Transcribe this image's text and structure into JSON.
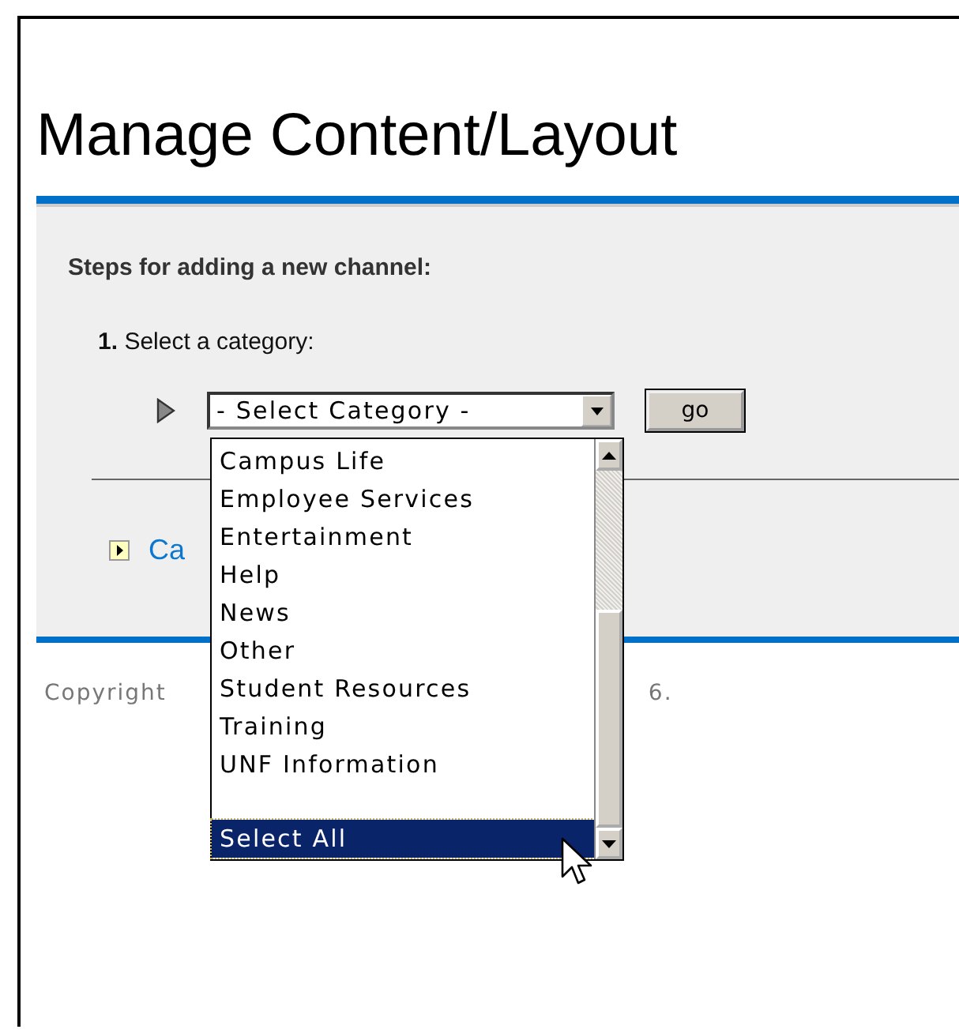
{
  "page": {
    "title": "Manage Content/Layout"
  },
  "steps": {
    "heading": "Steps for adding a new channel:",
    "step_number": "1.",
    "step_label": "Select a category:",
    "category_select": {
      "value": "- Select Category -",
      "expanded": true,
      "options": [
        {
          "label": "Campus Life",
          "selected": false
        },
        {
          "label": "Employee Services",
          "selected": false
        },
        {
          "label": "Entertainment",
          "selected": false
        },
        {
          "label": "Help",
          "selected": false
        },
        {
          "label": "News",
          "selected": false
        },
        {
          "label": "Other",
          "selected": false
        },
        {
          "label": "Student Resources",
          "selected": false
        },
        {
          "label": "Training",
          "selected": false
        },
        {
          "label": "UNF Information",
          "selected": false
        },
        {
          "label": "Select All",
          "selected": true
        }
      ]
    },
    "go_button": "go",
    "link_fragment": "Ca"
  },
  "footer": {
    "left_fragment": "Copyright",
    "right_fragment": "6."
  }
}
